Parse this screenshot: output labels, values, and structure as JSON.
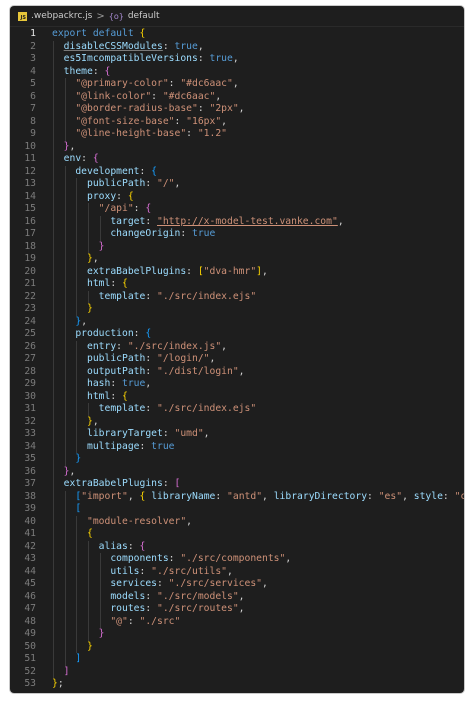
{
  "breadcrumb": {
    "js_badge": "JS",
    "file": ".webpackrc.js",
    "separator": ">",
    "symbol_icon": "{o}",
    "symbol": "default"
  },
  "colors": {
    "keyword": "#569cd6",
    "property": "#9cdcfe",
    "string": "#ce9178",
    "punctuation": "#d4d4d4",
    "bracket_level_1": "#ffd700",
    "bracket_level_2": "#da70d6",
    "bracket_level_3": "#179fff"
  },
  "editor": {
    "active_line": 1,
    "lines": [
      [
        [
          "export default ",
          "kw"
        ],
        [
          "{",
          "b1"
        ]
      ],
      [
        [
          "  "
        ],
        [
          "disableCSSModules",
          "prop under"
        ],
        [
          ": "
        ],
        [
          "true",
          "kw"
        ],
        [
          ","
        ]
      ],
      [
        [
          "  "
        ],
        [
          "es5ImcompatibleVersions",
          "prop"
        ],
        [
          ": "
        ],
        [
          "true",
          "kw"
        ],
        [
          ","
        ]
      ],
      [
        [
          "  "
        ],
        [
          "theme",
          "prop"
        ],
        [
          ": "
        ],
        [
          "{",
          "b2"
        ]
      ],
      [
        [
          "    "
        ],
        [
          "\"@primary-color\"",
          "str"
        ],
        [
          ": "
        ],
        [
          "\"#dc6aac\"",
          "str"
        ],
        [
          ","
        ]
      ],
      [
        [
          "    "
        ],
        [
          "\"@link-color\"",
          "str"
        ],
        [
          ": "
        ],
        [
          "\"#dc6aac\"",
          "str"
        ],
        [
          ","
        ]
      ],
      [
        [
          "    "
        ],
        [
          "\"@border-radius-base\"",
          "str"
        ],
        [
          ": "
        ],
        [
          "\"2px\"",
          "str"
        ],
        [
          ","
        ]
      ],
      [
        [
          "    "
        ],
        [
          "\"@font-size-base\"",
          "str"
        ],
        [
          ": "
        ],
        [
          "\"16px\"",
          "str"
        ],
        [
          ","
        ]
      ],
      [
        [
          "    "
        ],
        [
          "\"@line-height-base\"",
          "str"
        ],
        [
          ": "
        ],
        [
          "\"1.2\"",
          "str"
        ]
      ],
      [
        [
          "  "
        ],
        [
          "}",
          "b2"
        ],
        [
          ","
        ]
      ],
      [
        [
          "  "
        ],
        [
          "env",
          "prop"
        ],
        [
          ": "
        ],
        [
          "{",
          "b2"
        ]
      ],
      [
        [
          "    "
        ],
        [
          "development",
          "prop"
        ],
        [
          ": "
        ],
        [
          "{",
          "b3"
        ]
      ],
      [
        [
          "      "
        ],
        [
          "publicPath",
          "prop"
        ],
        [
          ": "
        ],
        [
          "\"/\"",
          "str"
        ],
        [
          ","
        ]
      ],
      [
        [
          "      "
        ],
        [
          "proxy",
          "prop"
        ],
        [
          ": "
        ],
        [
          "{",
          "b1"
        ]
      ],
      [
        [
          "        "
        ],
        [
          "\"/api\"",
          "str"
        ],
        [
          ": "
        ],
        [
          "{",
          "b2"
        ]
      ],
      [
        [
          "          "
        ],
        [
          "target",
          "prop"
        ],
        [
          ": "
        ],
        [
          "\"http://x-model-test.vanke.com\"",
          "link"
        ],
        [
          ","
        ]
      ],
      [
        [
          "          "
        ],
        [
          "changeOrigin",
          "prop"
        ],
        [
          ": "
        ],
        [
          "true",
          "kw"
        ]
      ],
      [
        [
          "        "
        ],
        [
          "}",
          "b2"
        ]
      ],
      [
        [
          "      "
        ],
        [
          "}",
          "b1"
        ],
        [
          ","
        ]
      ],
      [
        [
          "      "
        ],
        [
          "extraBabelPlugins",
          "prop"
        ],
        [
          ": "
        ],
        [
          "[",
          "b1"
        ],
        [
          "\"dva-hmr\"",
          "str"
        ],
        [
          "]",
          "b1"
        ],
        [
          ","
        ]
      ],
      [
        [
          "      "
        ],
        [
          "html",
          "prop"
        ],
        [
          ": "
        ],
        [
          "{",
          "b1"
        ]
      ],
      [
        [
          "        "
        ],
        [
          "template",
          "prop"
        ],
        [
          ": "
        ],
        [
          "\"./src/index.ejs\"",
          "str"
        ]
      ],
      [
        [
          "      "
        ],
        [
          "}",
          "b1"
        ]
      ],
      [
        [
          "    "
        ],
        [
          "}",
          "b3"
        ],
        [
          ","
        ]
      ],
      [
        [
          "    "
        ],
        [
          "production",
          "prop"
        ],
        [
          ": "
        ],
        [
          "{",
          "b3"
        ]
      ],
      [
        [
          "      "
        ],
        [
          "entry",
          "prop"
        ],
        [
          ": "
        ],
        [
          "\"./src/index.js\"",
          "str"
        ],
        [
          ","
        ]
      ],
      [
        [
          "      "
        ],
        [
          "publicPath",
          "prop"
        ],
        [
          ": "
        ],
        [
          "\"/login/\"",
          "str"
        ],
        [
          ","
        ]
      ],
      [
        [
          "      "
        ],
        [
          "outputPath",
          "prop"
        ],
        [
          ": "
        ],
        [
          "\"./dist/login\"",
          "str"
        ],
        [
          ","
        ]
      ],
      [
        [
          "      "
        ],
        [
          "hash",
          "prop"
        ],
        [
          ": "
        ],
        [
          "true",
          "kw"
        ],
        [
          ","
        ]
      ],
      [
        [
          "      "
        ],
        [
          "html",
          "prop"
        ],
        [
          ": "
        ],
        [
          "{",
          "b1"
        ]
      ],
      [
        [
          "        "
        ],
        [
          "template",
          "prop"
        ],
        [
          ": "
        ],
        [
          "\"./src/index.ejs\"",
          "str"
        ]
      ],
      [
        [
          "      "
        ],
        [
          "}",
          "b1"
        ],
        [
          ","
        ]
      ],
      [
        [
          "      "
        ],
        [
          "libraryTarget",
          "prop"
        ],
        [
          ": "
        ],
        [
          "\"umd\"",
          "str"
        ],
        [
          ","
        ]
      ],
      [
        [
          "      "
        ],
        [
          "multipage",
          "prop"
        ],
        [
          ": "
        ],
        [
          "true",
          "kw"
        ]
      ],
      [
        [
          "    "
        ],
        [
          "}",
          "b3"
        ]
      ],
      [
        [
          "  "
        ],
        [
          "}",
          "b2"
        ],
        [
          ","
        ]
      ],
      [
        [
          "  "
        ],
        [
          "extraBabelPlugins",
          "prop"
        ],
        [
          ": "
        ],
        [
          "[",
          "b2"
        ]
      ],
      [
        [
          "    "
        ],
        [
          "[",
          "b3"
        ],
        [
          "\"import\"",
          "str"
        ],
        [
          ", "
        ],
        [
          "{",
          "b1"
        ],
        [
          " "
        ],
        [
          "libraryName",
          "prop"
        ],
        [
          ": "
        ],
        [
          "\"antd\"",
          "str"
        ],
        [
          ", "
        ],
        [
          "libraryDirectory",
          "prop"
        ],
        [
          ": "
        ],
        [
          "\"es\"",
          "str"
        ],
        [
          ", "
        ],
        [
          "style",
          "prop"
        ],
        [
          ": "
        ],
        [
          "\"css\"",
          "str"
        ],
        [
          " "
        ],
        [
          "}",
          "b1"
        ],
        [
          "]",
          "b3"
        ],
        [
          ","
        ]
      ],
      [
        [
          "    "
        ],
        [
          "[",
          "b3"
        ]
      ],
      [
        [
          "      "
        ],
        [
          "\"module-resolver\"",
          "str"
        ],
        [
          ","
        ]
      ],
      [
        [
          "      "
        ],
        [
          "{",
          "b1"
        ]
      ],
      [
        [
          "        "
        ],
        [
          "alias",
          "prop"
        ],
        [
          ": "
        ],
        [
          "{",
          "b2"
        ]
      ],
      [
        [
          "          "
        ],
        [
          "components",
          "prop"
        ],
        [
          ": "
        ],
        [
          "\"./src/components\"",
          "str"
        ],
        [
          ","
        ]
      ],
      [
        [
          "          "
        ],
        [
          "utils",
          "prop"
        ],
        [
          ": "
        ],
        [
          "\"./src/utils\"",
          "str"
        ],
        [
          ","
        ]
      ],
      [
        [
          "          "
        ],
        [
          "services",
          "prop"
        ],
        [
          ": "
        ],
        [
          "\"./src/services\"",
          "str"
        ],
        [
          ","
        ]
      ],
      [
        [
          "          "
        ],
        [
          "models",
          "prop"
        ],
        [
          ": "
        ],
        [
          "\"./src/models\"",
          "str"
        ],
        [
          ","
        ]
      ],
      [
        [
          "          "
        ],
        [
          "routes",
          "prop"
        ],
        [
          ": "
        ],
        [
          "\"./src/routes\"",
          "str"
        ],
        [
          ","
        ]
      ],
      [
        [
          "          "
        ],
        [
          "\"@\"",
          "str"
        ],
        [
          ": "
        ],
        [
          "\"./src\"",
          "str"
        ]
      ],
      [
        [
          "        "
        ],
        [
          "}",
          "b2"
        ]
      ],
      [
        [
          "      "
        ],
        [
          "}",
          "b1"
        ]
      ],
      [
        [
          "    "
        ],
        [
          "]",
          "b3"
        ]
      ],
      [
        [
          "  "
        ],
        [
          "]",
          "b2"
        ]
      ],
      [
        [
          "}",
          "b1"
        ],
        [
          ";"
        ]
      ]
    ]
  }
}
